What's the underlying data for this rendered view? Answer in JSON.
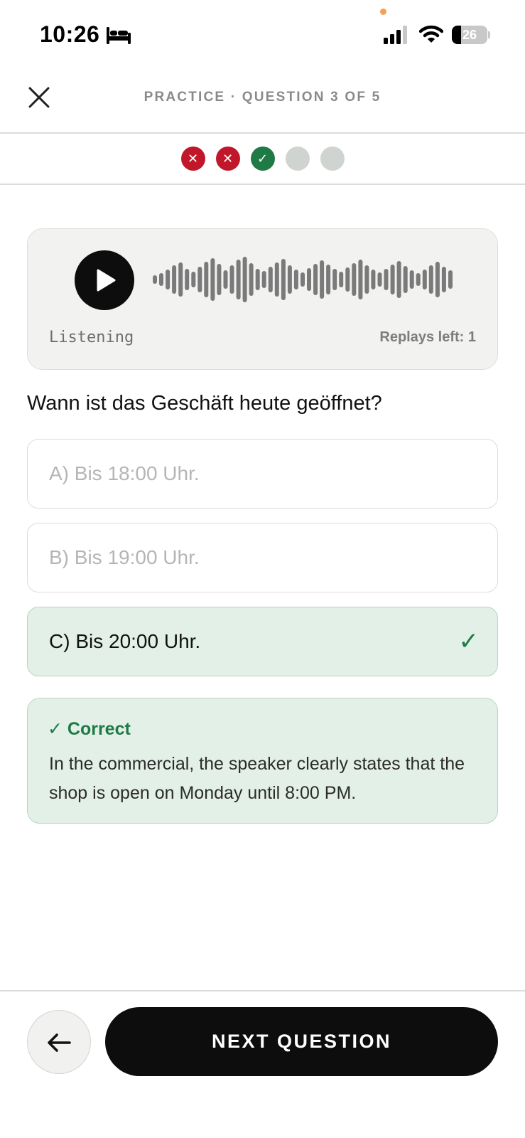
{
  "status_bar": {
    "time": "10:26",
    "battery_level": "26",
    "battery_fraction": 0.26,
    "icons": [
      "sleep-bed-icon",
      "cellular-signal-icon",
      "wifi-icon",
      "battery-icon"
    ]
  },
  "header": {
    "title": "PRACTICE · QUESTION 3 OF 5",
    "close_icon": "close-icon"
  },
  "progress": {
    "total": 5,
    "current": 3,
    "results": [
      "wrong",
      "wrong",
      "correct",
      "pending",
      "pending"
    ],
    "wrong_symbol": "✕",
    "correct_symbol": "✓"
  },
  "audio": {
    "play_icon": "play-icon",
    "status": "Listening",
    "replays_label": "Replays left: 1"
  },
  "question": {
    "text": "Wann ist das Geschäft heute geöffnet?",
    "options": [
      {
        "label": "A) Bis 18:00 Uhr.",
        "state": "dimmed"
      },
      {
        "label": "B) Bis 19:00 Uhr.",
        "state": "dimmed"
      },
      {
        "label": "C) Bis 20:00 Uhr.",
        "state": "correct-selected",
        "mark": "✓"
      }
    ]
  },
  "feedback": {
    "title": "✓ Correct",
    "text": "In the commercial, the speaker clearly states that the shop is open on Monday until 8:00 PM."
  },
  "footer": {
    "back_icon": "arrow-left-icon",
    "next_label": "NEXT QUESTION"
  },
  "colors": {
    "wrong": "#c0172a",
    "correct": "#1f7a46",
    "pending": "#cfd4d0",
    "correct_bg": "#e3f0e7",
    "button_dark": "#0d0d0d"
  }
}
